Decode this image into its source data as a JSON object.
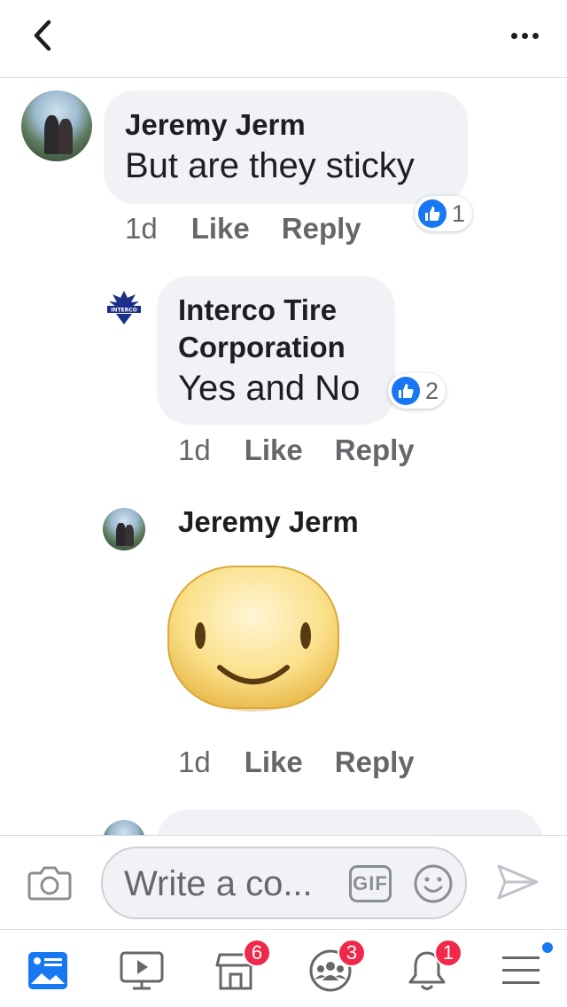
{
  "header": {
    "back_icon": "chevron-left-icon",
    "more_icon": "more-horizontal-icon"
  },
  "comments": [
    {
      "author": "Jeremy Jerm",
      "text": "But are they sticky",
      "time": "1d",
      "like_label": "Like",
      "reply_label": "Reply",
      "reaction_count": "1"
    },
    {
      "author_line1": "Interco Tire",
      "author_line2": "Corporation",
      "text": "Yes and No",
      "time": "1d",
      "like_label": "Like",
      "reply_label": "Reply",
      "reaction_count": "2"
    },
    {
      "author": "Jeremy Jerm",
      "sticker": "smiley-sticker",
      "time": "1d",
      "like_label": "Like",
      "reply_label": "Reply"
    }
  ],
  "logo_text": "INTERCO",
  "composer": {
    "placeholder": "Write a co...",
    "gif_label": "GIF"
  },
  "tabs": [
    {
      "name": "news-feed",
      "badge": ""
    },
    {
      "name": "watch",
      "badge": ""
    },
    {
      "name": "marketplace",
      "badge": "6"
    },
    {
      "name": "groups",
      "badge": "3"
    },
    {
      "name": "notifications",
      "badge": "1"
    },
    {
      "name": "menu",
      "badge": ""
    }
  ],
  "colors": {
    "accent": "#1877f2",
    "badge": "#f02849",
    "bubble": "#f0f2f5"
  }
}
